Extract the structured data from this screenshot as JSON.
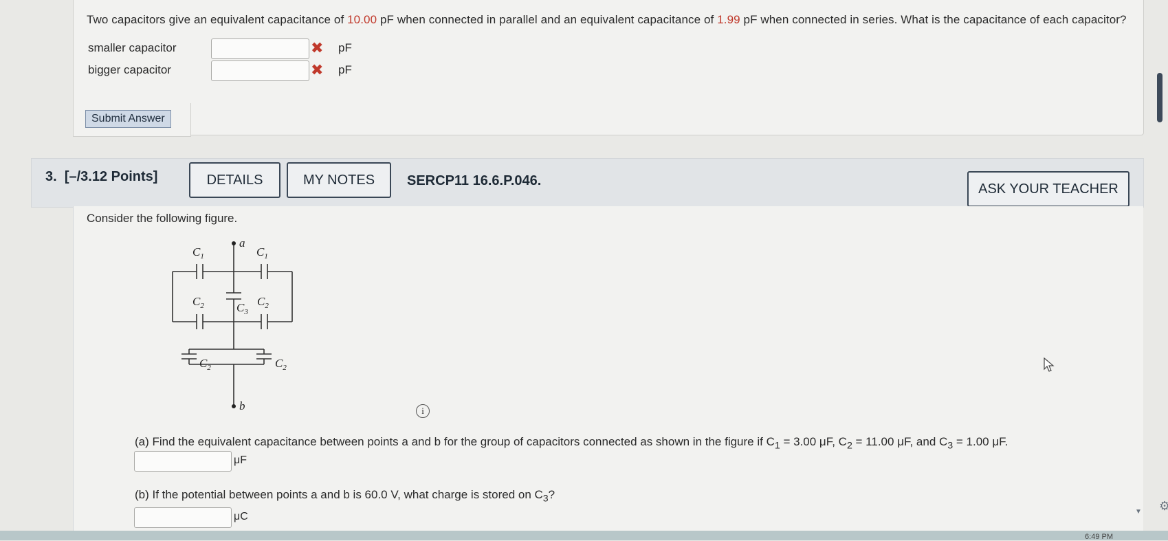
{
  "prev_question": {
    "text_parts": [
      "Two capacitors give an equivalent capacitance of ",
      "10.00",
      " pF when connected in parallel and an equivalent capacitance of ",
      "1.99",
      " pF when connected in series. What is the capacitance of each capacitor?"
    ],
    "rows": [
      {
        "label": "smaller capacitor",
        "unit": "pF"
      },
      {
        "label": "bigger capacitor",
        "unit": "pF"
      }
    ],
    "submit_label": "Submit Answer"
  },
  "q3": {
    "number": "3.",
    "points": "[–/3.12 Points]",
    "details_label": "DETAILS",
    "notes_label": "MY NOTES",
    "code": "SERCP11 16.6.P.046.",
    "ask_label": "ASK YOUR TEACHER",
    "consider": "Consider the following figure.",
    "figure_labels": {
      "c1": "C",
      "c1_sub": "1",
      "c2": "C",
      "c2_sub": "2",
      "c3": "C",
      "c3_sub": "3",
      "a": "a",
      "b": "b"
    },
    "info_icon": "i",
    "part_a": {
      "prefix": "(a) Find the equivalent capacitance between points a and b for the group of capacitors connected as shown in the figure if C",
      "sub1": "1",
      "mid1": " = 3.00 μF, C",
      "sub2": "2",
      "mid2": " = 11.00 μF, and C",
      "sub3": "3",
      "end": " = 1.00 μF.",
      "unit": "μF"
    },
    "part_b": {
      "prefix": "(b) If the potential between points a and b is 60.0 V, what charge is stored on C",
      "sub": "3",
      "end": "?",
      "unit": "μC"
    }
  },
  "taskbar": {
    "time": "6:49 PM"
  },
  "colors": {
    "highlight": "#c0392b",
    "header_bg": "#e1e4e7",
    "button_border": "#3a4756"
  },
  "icons": [
    "x-icon",
    "info-icon",
    "mouse-cursor-icon",
    "gear-icon",
    "chevron-down-icon"
  ]
}
